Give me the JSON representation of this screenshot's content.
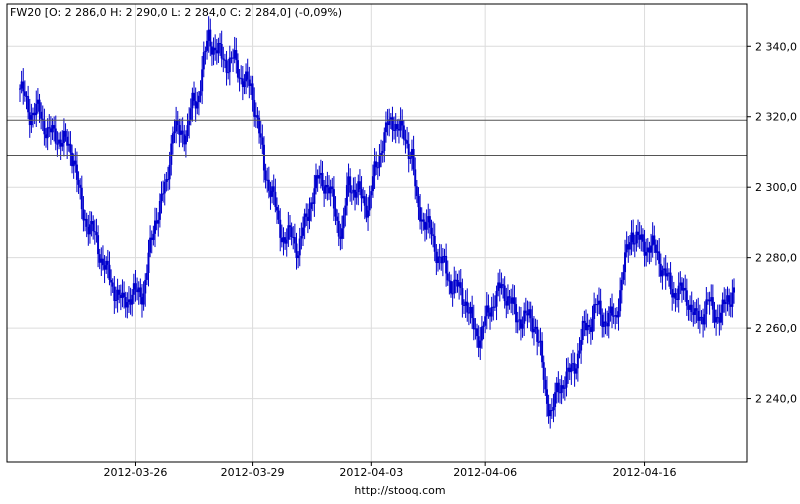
{
  "chart_data": {
    "type": "candlestick",
    "legend": "FW20 [O: 2 286,0  H: 2 290,0  L: 2 284,0  C: 2 284,0] (-0,09%)",
    "footer": "http://stooq.com",
    "ylim": [
      2222,
      2352
    ],
    "y_ticks": [
      {
        "value": 2240,
        "label": "2 240,0"
      },
      {
        "value": 2260,
        "label": "2 260,0"
      },
      {
        "value": 2280,
        "label": "2 280,0"
      },
      {
        "value": 2300,
        "label": "2 300,0"
      },
      {
        "value": 2320,
        "label": "2 320,0"
      },
      {
        "value": 2340,
        "label": "2 340,0"
      }
    ],
    "x_ticks": [
      {
        "index": 71,
        "label": "2012-03-26"
      },
      {
        "index": 143,
        "label": "2012-03-29"
      },
      {
        "index": 216,
        "label": "2012-04-03"
      },
      {
        "index": 286,
        "label": "2012-04-06"
      },
      {
        "index": 384,
        "label": "2012-04-16"
      }
    ],
    "x_count": 440,
    "hlines": [
      2319,
      2309
    ],
    "colors": {
      "candle": "#0000cc",
      "hline": "#555555",
      "grid": "#dcdcdc",
      "axis": "#000000"
    },
    "anchors": [
      [
        0,
        2328
      ],
      [
        6,
        2320
      ],
      [
        12,
        2322
      ],
      [
        18,
        2316
      ],
      [
        26,
        2312
      ],
      [
        33,
        2310
      ],
      [
        38,
        2294
      ],
      [
        43,
        2288
      ],
      [
        48,
        2282
      ],
      [
        54,
        2276
      ],
      [
        60,
        2270
      ],
      [
        63,
        2266
      ],
      [
        67,
        2268
      ],
      [
        72,
        2270
      ],
      [
        76,
        2272
      ],
      [
        79,
        2280
      ],
      [
        83,
        2290
      ],
      [
        87,
        2295
      ],
      [
        90,
        2300
      ],
      [
        94,
        2318
      ],
      [
        98,
        2316
      ],
      [
        103,
        2316
      ],
      [
        106,
        2322
      ],
      [
        109,
        2324
      ],
      [
        113,
        2336
      ],
      [
        116,
        2344
      ],
      [
        120,
        2340
      ],
      [
        124,
        2336
      ],
      [
        128,
        2334
      ],
      [
        132,
        2336
      ],
      [
        137,
        2332
      ],
      [
        142,
        2328
      ],
      [
        146,
        2318
      ],
      [
        150,
        2304
      ],
      [
        155,
        2300
      ],
      [
        159,
        2290
      ],
      [
        163,
        2285
      ],
      [
        167,
        2285
      ],
      [
        171,
        2282
      ],
      [
        175,
        2290
      ],
      [
        179,
        2298
      ],
      [
        184,
        2302
      ],
      [
        188,
        2300
      ],
      [
        192,
        2296
      ],
      [
        196,
        2290
      ],
      [
        198,
        2288
      ],
      [
        202,
        2302
      ],
      [
        206,
        2298
      ],
      [
        210,
        2296
      ],
      [
        214,
        2295
      ],
      [
        218,
        2305
      ],
      [
        222,
        2312
      ],
      [
        226,
        2316
      ],
      [
        230,
        2318
      ],
      [
        234,
        2316
      ],
      [
        238,
        2314
      ],
      [
        241,
        2310
      ],
      [
        244,
        2294
      ],
      [
        248,
        2290
      ],
      [
        253,
        2286
      ],
      [
        257,
        2282
      ],
      [
        261,
        2278
      ],
      [
        265,
        2272
      ],
      [
        269,
        2270
      ],
      [
        274,
        2268
      ],
      [
        278,
        2262
      ],
      [
        283,
        2258
      ],
      [
        287,
        2262
      ],
      [
        292,
        2268
      ],
      [
        296,
        2272
      ],
      [
        301,
        2270
      ],
      [
        305,
        2262
      ],
      [
        309,
        2262
      ],
      [
        313,
        2262
      ],
      [
        317,
        2262
      ],
      [
        320,
        2254
      ],
      [
        323,
        2242
      ],
      [
        327,
        2235
      ],
      [
        330,
        2240
      ],
      [
        334,
        2245
      ],
      [
        338,
        2248
      ],
      [
        342,
        2252
      ],
      [
        346,
        2258
      ],
      [
        350,
        2260
      ],
      [
        354,
        2266
      ],
      [
        358,
        2264
      ],
      [
        362,
        2264
      ],
      [
        366,
        2262
      ],
      [
        371,
        2275
      ],
      [
        376,
        2288
      ],
      [
        380,
        2286
      ],
      [
        384,
        2284
      ],
      [
        388,
        2282
      ],
      [
        392,
        2280
      ],
      [
        396,
        2276
      ],
      [
        401,
        2272
      ],
      [
        406,
        2270
      ],
      [
        410,
        2268
      ],
      [
        415,
        2262
      ],
      [
        419,
        2265
      ],
      [
        423,
        2268
      ],
      [
        427,
        2264
      ],
      [
        431,
        2262
      ],
      [
        435,
        2268
      ],
      [
        439,
        2272
      ],
      [
        443,
        2278
      ],
      [
        447,
        2285
      ]
    ]
  }
}
